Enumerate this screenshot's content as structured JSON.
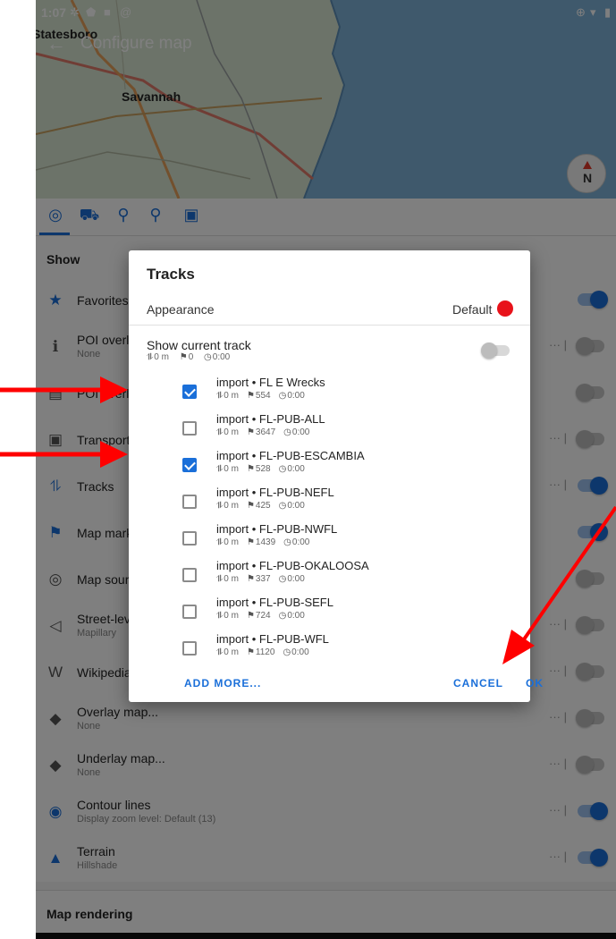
{
  "status_bar": {
    "time": "1:07",
    "left_icons": [
      "settings-icon",
      "shield-icon",
      "image-icon",
      "at-icon"
    ],
    "right_icons": [
      "vpn-icon",
      "wifi-icon",
      "battery-icon"
    ]
  },
  "map": {
    "title": "Configure map",
    "cities": {
      "top": "Statesboro",
      "mid": "Savannah"
    },
    "compass_label": "N"
  },
  "profile_tabs": [
    "globe-icon",
    "car-icon",
    "bicycle-icon",
    "pedestrian-icon",
    "bus-icon"
  ],
  "settings": {
    "show_header": "Show",
    "rows": [
      {
        "title": "Favorites",
        "sub": "",
        "icon": "star-icon",
        "toggle": true,
        "dots": false
      },
      {
        "title": "POI overlay",
        "sub": "None",
        "icon": "info-icon",
        "toggle": false,
        "dots": true
      },
      {
        "title": "POI overlay labels",
        "sub": "",
        "icon": "book-icon",
        "toggle": false,
        "dots": false
      },
      {
        "title": "Transport",
        "sub": "",
        "icon": "bus-icon",
        "toggle": false,
        "dots": true
      },
      {
        "title": "Tracks",
        "sub": "",
        "icon": "route-icon",
        "toggle": true,
        "dots": true
      },
      {
        "title": "Map markers",
        "sub": "",
        "icon": "flag-icon",
        "toggle": true,
        "dots": false
      },
      {
        "title": "Map source",
        "sub": "",
        "icon": "globe-icon",
        "toggle": false,
        "dots": false
      },
      {
        "title": "Street-level imagery",
        "sub": "Mapillary",
        "icon": "street-icon",
        "toggle": false,
        "dots": true
      },
      {
        "title": "Wikipedia",
        "sub": "",
        "icon": "wikipedia-icon",
        "toggle": false,
        "dots": true
      },
      {
        "title": "Overlay map...",
        "sub": "None",
        "icon": "layers-icon",
        "toggle": false,
        "dots": true
      },
      {
        "title": "Underlay map...",
        "sub": "None",
        "icon": "layers-icon",
        "toggle": false,
        "dots": true
      },
      {
        "title": "Contour lines",
        "sub": "Display zoom level: Default (13)",
        "icon": "contour-icon",
        "toggle": true,
        "dots": true
      },
      {
        "title": "Terrain",
        "sub": "Hillshade",
        "icon": "terrain-icon",
        "toggle": true,
        "dots": true
      }
    ],
    "bottom_section": "Map rendering"
  },
  "dialog": {
    "title": "Tracks",
    "appearance_label": "Appearance",
    "appearance_value": "Default",
    "appearance_color": "#e8121a",
    "current_track": {
      "title": "Show current track",
      "distance": "0 m",
      "points": "0",
      "time": "0:00",
      "enabled": false
    },
    "tracks": [
      {
        "name": "import • FL E Wrecks",
        "distance": "0 m",
        "points": "554",
        "time": "0:00",
        "checked": true
      },
      {
        "name": "import • FL-PUB-ALL",
        "distance": "0 m",
        "points": "3647",
        "time": "0:00",
        "checked": false
      },
      {
        "name": "import • FL-PUB-ESCAMBIA",
        "distance": "0 m",
        "points": "528",
        "time": "0:00",
        "checked": true
      },
      {
        "name": "import • FL-PUB-NEFL",
        "distance": "0 m",
        "points": "425",
        "time": "0:00",
        "checked": false
      },
      {
        "name": "import • FL-PUB-NWFL",
        "distance": "0 m",
        "points": "1439",
        "time": "0:00",
        "checked": false
      },
      {
        "name": "import • FL-PUB-OKALOOSA",
        "distance": "0 m",
        "points": "337",
        "time": "0:00",
        "checked": false
      },
      {
        "name": "import • FL-PUB-SEFL",
        "distance": "0 m",
        "points": "724",
        "time": "0:00",
        "checked": false
      },
      {
        "name": "import • FL-PUB-WFL",
        "distance": "0 m",
        "points": "1120",
        "time": "0:00",
        "checked": false
      }
    ],
    "buttons": {
      "add_more": "ADD MORE...",
      "cancel": "CANCEL",
      "ok": "OK"
    }
  },
  "colors": {
    "accent": "#1a6fd9",
    "annotation": "#ff0000"
  }
}
